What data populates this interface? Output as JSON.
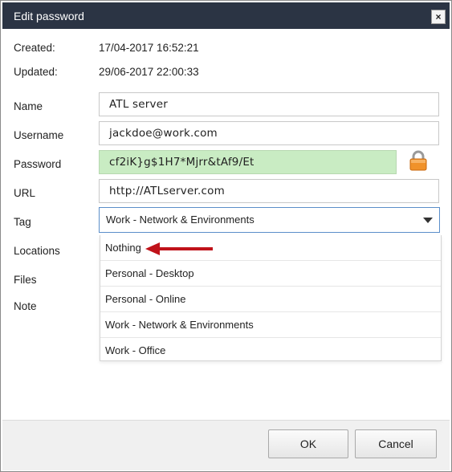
{
  "dialog": {
    "title": "Edit password",
    "close_glyph": "×",
    "created_label": "Created:",
    "created_value": "17/04-2017 16:52:21",
    "updated_label": "Updated:",
    "updated_value": "29/06-2017 22:00:33",
    "fields": {
      "name_label": "Name",
      "name_value": "ATL server",
      "username_label": "Username",
      "username_value": "jackdoe@work.com",
      "password_label": "Password",
      "password_value": "cf2iK}g$1H7*Mjrr&tAf9/Et",
      "url_label": "URL",
      "url_value": "http://ATLserver.com",
      "tag_label": "Tag",
      "tag_value": "Work - Network & Environments",
      "locations_label": "Locations",
      "files_label": "Files",
      "note_label": "Note"
    },
    "tag_options": [
      "Nothing",
      "Personal - Desktop",
      "Personal - Online",
      "Work - Network & Environments",
      "Work - Office"
    ],
    "ok_label": "OK",
    "cancel_label": "Cancel"
  },
  "icons": {
    "lock": "lock-icon",
    "caret": "chevron-down-icon",
    "close": "close-icon",
    "arrow": "arrow-left-icon"
  },
  "colors": {
    "titlebar": "#2b3444",
    "password_bg": "#c9ecc3",
    "annotation_arrow": "#c0121a",
    "select_border": "#5b8ec9"
  }
}
